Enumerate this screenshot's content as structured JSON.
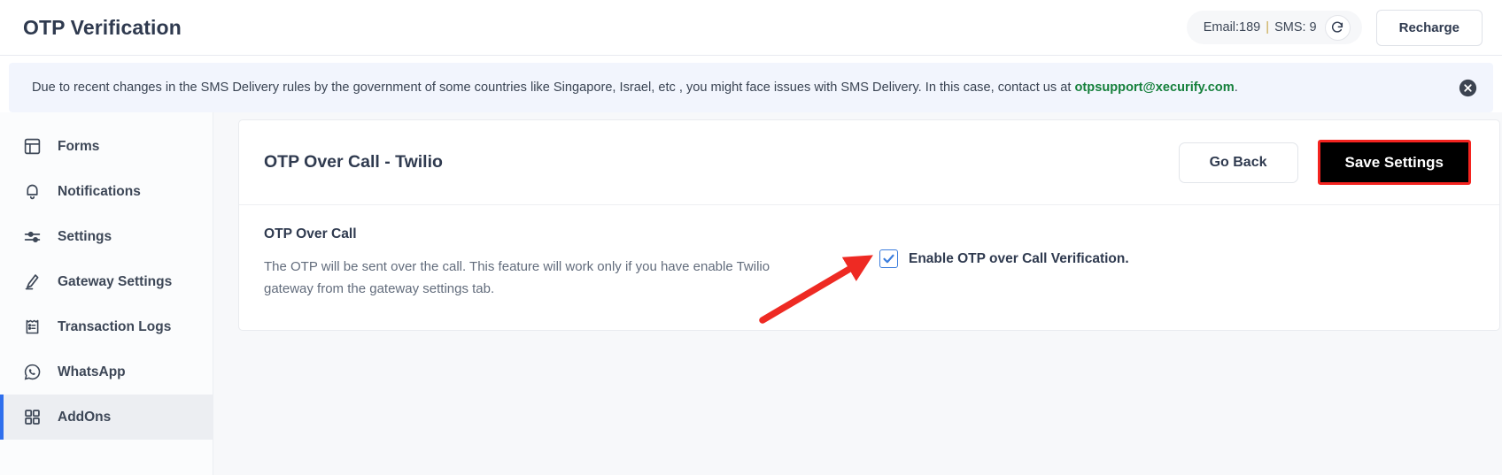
{
  "header": {
    "title": "OTP Verification",
    "balance": {
      "email_label": "Email:189",
      "separator": "|",
      "sms_label": "SMS: 9",
      "refresh_icon": "refresh-icon"
    },
    "recharge_label": "Recharge"
  },
  "banner": {
    "text_before_link": "Due to recent changes in the SMS Delivery rules by the government of some countries like Singapore, Israel, etc , you might face issues with SMS Delivery. In this case, contact us at ",
    "link_text": "otpsupport@xecurify.com",
    "text_after_link": ".",
    "close_icon": "close-circle-icon",
    "background": "#f2f5fd",
    "link_color": "#16803c"
  },
  "sidebar": {
    "items": [
      {
        "label": "Forms",
        "icon": "layout-panel-icon",
        "active": false
      },
      {
        "label": "Notifications",
        "icon": "bell-icon",
        "active": false
      },
      {
        "label": "Settings",
        "icon": "sliders-icon",
        "active": false
      },
      {
        "label": "Gateway Settings",
        "icon": "pen-icon",
        "active": false
      },
      {
        "label": "Transaction Logs",
        "icon": "clipboard-list-icon",
        "active": false
      },
      {
        "label": "WhatsApp",
        "icon": "whatsapp-icon",
        "active": false
      },
      {
        "label": "AddOns",
        "icon": "grid-squares-icon",
        "active": true
      }
    ],
    "active_accent": "#2f6fed"
  },
  "card": {
    "title": "OTP Over Call - Twilio",
    "go_back_label": "Go Back",
    "save_label": "Save Settings",
    "save_highlight_color": "#f4231f",
    "section": {
      "title": "OTP Over Call",
      "description": "The OTP will be sent over the call. This feature will work only if you have enable Twilio gateway from the gateway settings tab."
    },
    "checkbox": {
      "label": "Enable OTP over Call Verification.",
      "checked": true,
      "accent": "#3b7ddd"
    }
  },
  "annotation": {
    "arrow_color": "#ee2a23",
    "points_to": "enable-otp-over-call-checkbox"
  }
}
